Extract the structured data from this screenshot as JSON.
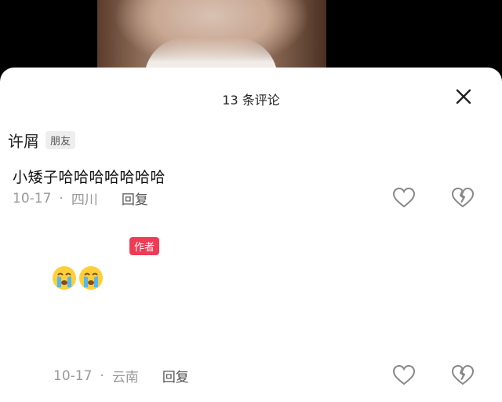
{
  "header": {
    "comment_count_label": "13 条评论"
  },
  "comments": [
    {
      "author": "许屑",
      "badge": "朋友",
      "text": "小矮子哈哈哈哈哈哈哈",
      "date": "10-17",
      "location": "四川",
      "reply_label": "回复"
    },
    {
      "badge": "作者",
      "emojis": [
        "crying-face",
        "crying-face"
      ],
      "date": "10-17",
      "location": "云南",
      "reply_label": "回复"
    }
  ],
  "colors": {
    "author_badge": "#ef3b55",
    "meta_text": "#999999",
    "sheet_bg": "#ffffff"
  }
}
